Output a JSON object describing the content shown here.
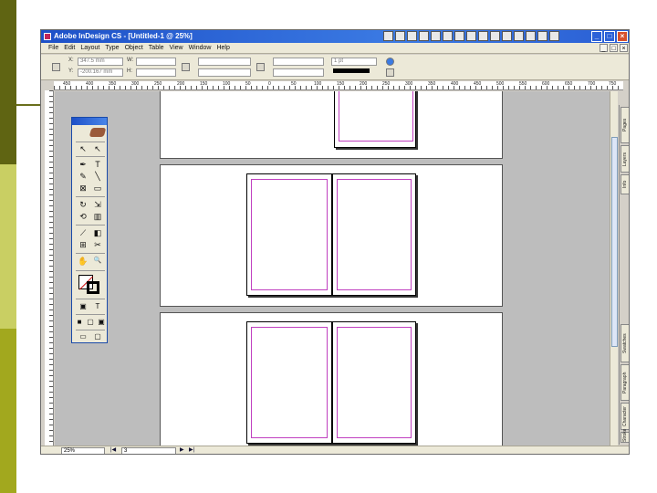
{
  "app": {
    "title": "Adobe InDesign CS - [Untitled-1 @ 25%]",
    "doc_controls": [
      "_",
      "□",
      "×"
    ]
  },
  "menubar": {
    "items": [
      "File",
      "Edit",
      "Layout",
      "Type",
      "Object",
      "Table",
      "View",
      "Window",
      "Help"
    ]
  },
  "controlbar": {
    "x_value": "347.5 mm",
    "y_value": "-200.167 mm",
    "w_label": "W:",
    "h_label": "H:",
    "stroke_weight": "1 pt"
  },
  "ruler": {
    "h_labels": [
      "450",
      "400",
      "350",
      "300",
      "250",
      "200",
      "150",
      "100",
      "50",
      "0",
      "50",
      "100",
      "150",
      "200",
      "250",
      "300",
      "350",
      "400",
      "450",
      "500",
      "550",
      "600",
      "650",
      "700",
      "750"
    ]
  },
  "side_tabs": [
    "Pages",
    "Layers",
    "Info",
    "Swatches",
    "Paragraph Styles",
    "Character Styles",
    "Stroke"
  ],
  "statusbar": {
    "zoom": "25%",
    "page": "3",
    "nav_first": "|◀",
    "nav_prev": "◀",
    "nav_next": "▶",
    "nav_last": "▶|"
  },
  "toolbox": {
    "tools": [
      {
        "name": "selection-tool-icon",
        "glyph": "↖"
      },
      {
        "name": "direct-selection-tool-icon",
        "glyph": "↖"
      },
      {
        "name": "pen-tool-icon",
        "glyph": "✒"
      },
      {
        "name": "type-tool-icon",
        "glyph": "T"
      },
      {
        "name": "pencil-tool-icon",
        "glyph": "✎"
      },
      {
        "name": "line-tool-icon",
        "glyph": "╲"
      },
      {
        "name": "rectangle-frame-tool-icon",
        "glyph": "⊠"
      },
      {
        "name": "rectangle-tool-icon",
        "glyph": "▭"
      },
      {
        "name": "rotate-tool-icon",
        "glyph": "↻"
      },
      {
        "name": "scale-tool-icon",
        "glyph": "⇲"
      },
      {
        "name": "free-transform-tool-icon",
        "glyph": "⟲"
      },
      {
        "name": "gradient-tool-icon",
        "glyph": "▥"
      },
      {
        "name": "eyedropper-tool-icon",
        "glyph": "⟋"
      },
      {
        "name": "gradient-swatch-icon",
        "glyph": "◧"
      },
      {
        "name": "button-tool-icon",
        "glyph": "⊞"
      },
      {
        "name": "scissors-tool-icon",
        "glyph": "✂"
      },
      {
        "name": "hand-tool-icon",
        "glyph": "✋"
      },
      {
        "name": "zoom-tool-icon",
        "glyph": "🔍"
      },
      {
        "name": "formatting-container-icon",
        "glyph": "▣"
      },
      {
        "name": "formatting-text-icon",
        "glyph": "T"
      },
      {
        "name": "normal-view-icon",
        "glyph": "■"
      },
      {
        "name": "preview-view-icon",
        "glyph": "▢"
      },
      {
        "name": "bleed-view-icon",
        "glyph": "▣"
      }
    ]
  },
  "colors": {
    "title_bar": "#2a5fd4",
    "margin_guides": "#c040c0",
    "pasteboard": "#bdbdbd"
  }
}
